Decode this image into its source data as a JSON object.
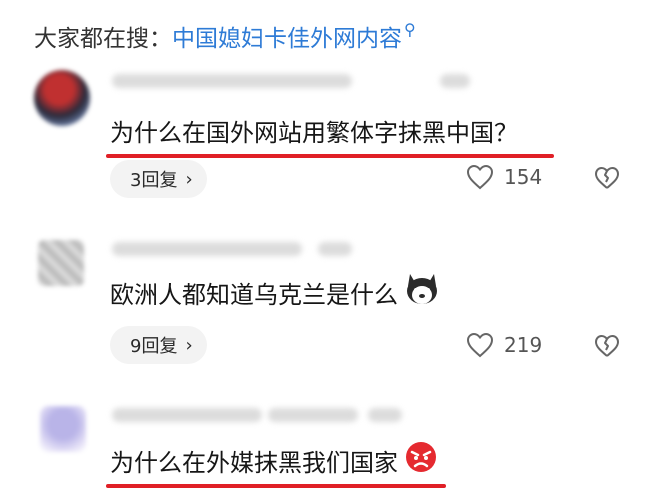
{
  "search": {
    "prefix": "大家都在搜：",
    "query": "中国媳妇卡佳外网内容",
    "icon": "search-icon"
  },
  "comments": [
    {
      "text": "为什么在国外网站用繁体字抹黑中国？",
      "reply_label": "3回复",
      "likes": "154",
      "underline_color": "#e01f26"
    },
    {
      "text": "欧洲人都知道乌克兰是什么",
      "reply_label": "9回复",
      "likes": "219",
      "emoji_icon": "husky-dog-icon"
    },
    {
      "text": "为什么在外媒抹黑我们国家",
      "emoji_icon": "angry-face-icon",
      "underline_color": "#e01f26"
    }
  ],
  "colors": {
    "accent": "#2e7bd6",
    "underline": "#e01f26",
    "pill_bg": "#f3f3f3"
  }
}
